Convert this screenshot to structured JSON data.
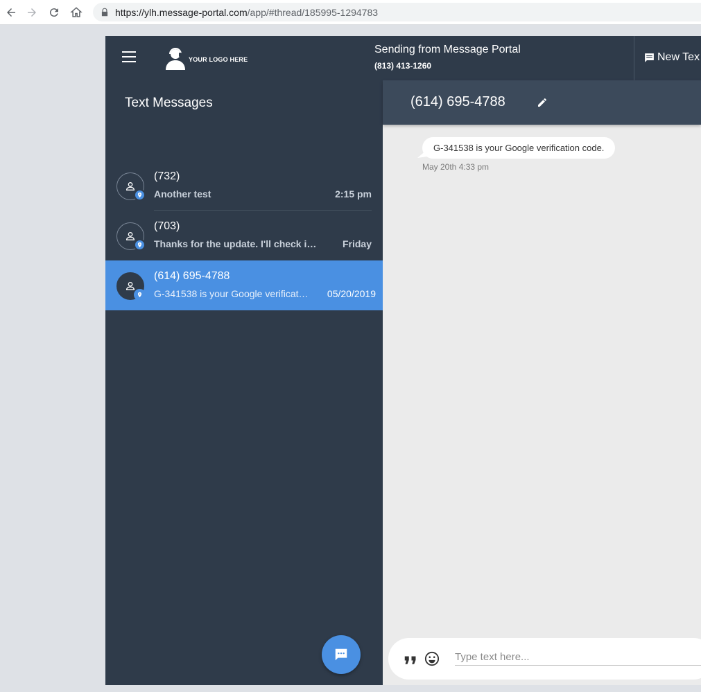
{
  "browser": {
    "url_host": "https://ylh.message-portal.com",
    "url_path": "/app/#thread/185995-1294783"
  },
  "topbar": {
    "logo_text": "YOUR LOGO HERE",
    "sending_title": "Sending from Message Portal",
    "sending_number": "(813) 413-1260",
    "new_text_label": "New Tex"
  },
  "sidebar": {
    "title": "Text Messages",
    "threads": [
      {
        "name": "(732)",
        "preview": "Another test",
        "time": "2:15 pm",
        "active": false
      },
      {
        "name": "(703)",
        "preview": "Thanks for the update. I'll check i…",
        "time": "Friday",
        "active": false
      },
      {
        "name": "(614) 695-4788",
        "preview": "G-341538 is your Google verificat…",
        "time": "05/20/2019",
        "active": true
      }
    ]
  },
  "conversation": {
    "title": "(614) 695-4788",
    "messages": [
      {
        "text": "G-341538 is your Google verification code.",
        "time": "May 20th 4:33 pm"
      }
    ],
    "composer_placeholder": "Type text here..."
  },
  "colors": {
    "app_bg": "#2f3b4a",
    "accent": "#4a90e2",
    "convo_header": "#3c4a5b",
    "convo_bg": "#ebebeb"
  }
}
